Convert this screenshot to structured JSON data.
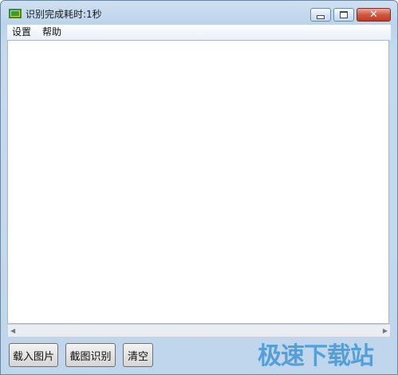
{
  "window": {
    "title": "识别完成耗时:1秒"
  },
  "menu": {
    "items": [
      "设置",
      "帮助"
    ]
  },
  "buttons": {
    "load": "载入图片",
    "capture": "截图识别",
    "clear": "清空"
  },
  "watermark": "极速下载站",
  "icons": {
    "app": "app-icon",
    "minimize": "minimize-icon",
    "maximize": "maximize-icon",
    "close": "close-icon"
  }
}
